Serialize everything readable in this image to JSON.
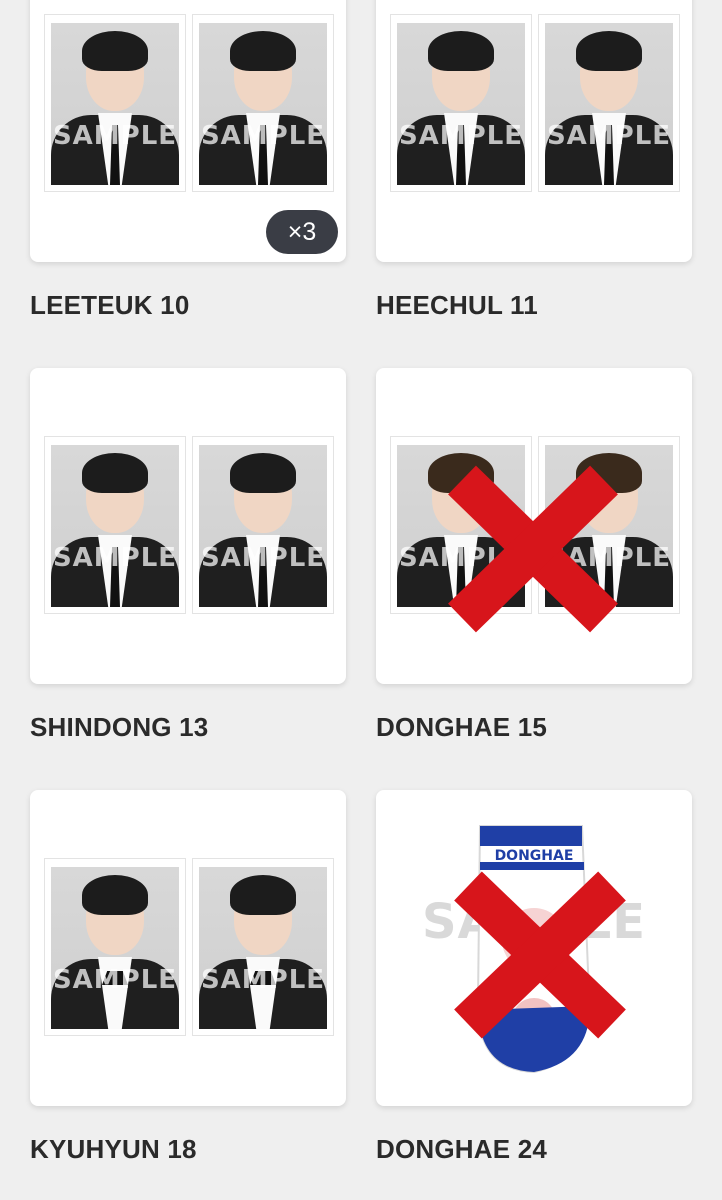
{
  "watermark": "SAMPLE",
  "cross_color": "#d7151b",
  "items": [
    {
      "label": "LEETEUK 10",
      "badge": "×3",
      "crossed": false
    },
    {
      "label": "HEECHUL 11",
      "crossed": false
    },
    {
      "label": "SHINDONG 13",
      "crossed": false
    },
    {
      "label": "DONGHAE 15",
      "crossed": true
    },
    {
      "label": "KYUHYUN 18",
      "crossed": false
    },
    {
      "label": "DONGHAE 24",
      "sock_text": "DONGHAE",
      "crossed": true
    }
  ]
}
